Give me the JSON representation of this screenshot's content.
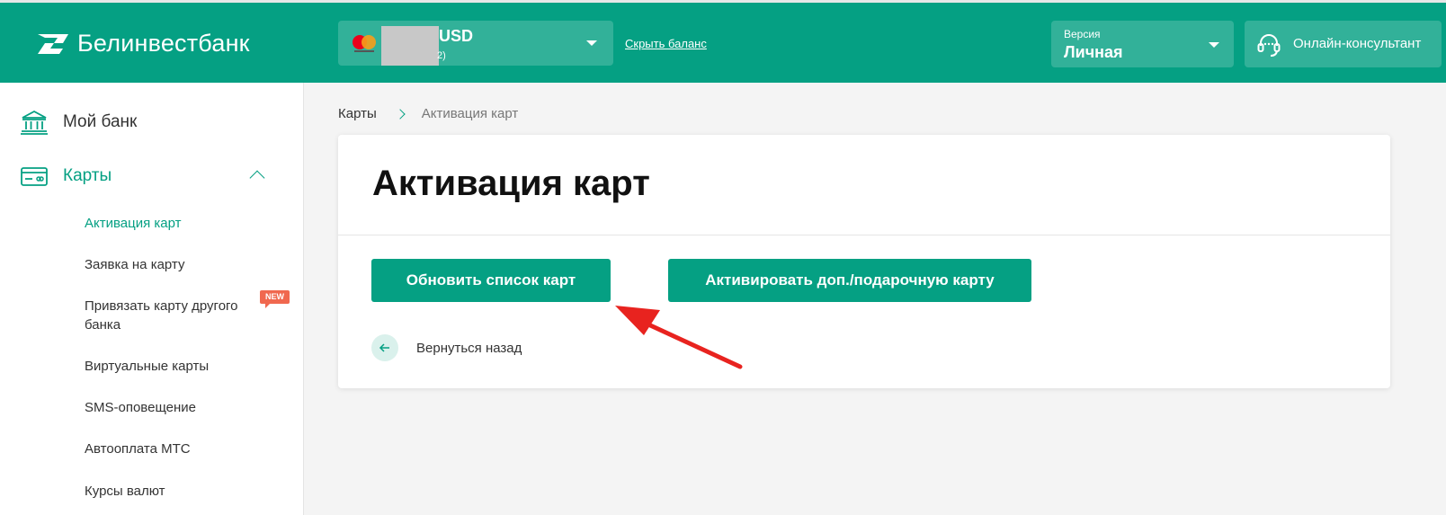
{
  "header": {
    "bank_name": "Белинвестбанк",
    "account": {
      "currency": "USD",
      "sub_text": "2)"
    },
    "hide_balance_label": "Скрыть баланс",
    "version": {
      "label": "Версия",
      "value": "Личная"
    },
    "consultant_label": "Онлайн-консультант"
  },
  "sidebar": {
    "my_bank_label": "Мой банк",
    "cards_label": "Карты",
    "sub_items": [
      {
        "label": "Активация карт"
      },
      {
        "label": "Заявка на карту"
      },
      {
        "label": "Привязать карту другого банка"
      },
      {
        "label": "Виртуальные карты"
      },
      {
        "label": "SMS-оповещение"
      },
      {
        "label": "Автооплата МТС"
      },
      {
        "label": "Курсы валют"
      }
    ],
    "new_badge": "NEW"
  },
  "breadcrumb": {
    "items": [
      "Карты",
      "Активация карт"
    ]
  },
  "page": {
    "title": "Активация карт",
    "refresh_button": "Обновить список карт",
    "activate_button": "Активировать доп./подарочную карту",
    "back_label": "Вернуться назад"
  },
  "colors": {
    "brand": "#05a083",
    "badge": "#f0684f",
    "annotation_arrow": "#e8231f"
  }
}
